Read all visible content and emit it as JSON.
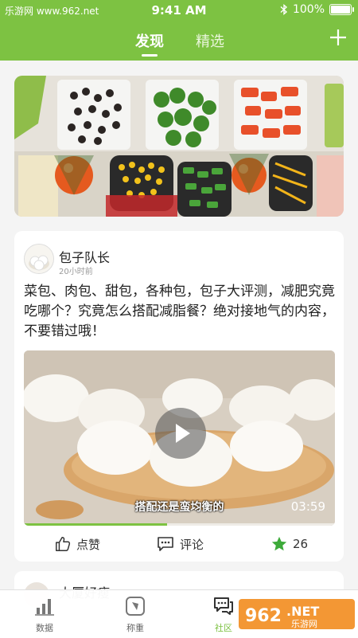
{
  "status_bar": {
    "carrier": "乐游网 www.962.net",
    "time": "9:41 AM",
    "battery": "100%",
    "battery_level": 1.0
  },
  "header": {
    "tabs": [
      {
        "label": "发现",
        "active": true
      },
      {
        "label": "精选",
        "active": false
      }
    ],
    "add_icon": "plus-icon"
  },
  "post": {
    "author": "包子队长",
    "time": "20小时前",
    "text": "菜包、肉包、甜包，各种包，包子大评测，减肥究竟吃哪个？究竟怎么搭配减脂餐？绝对接地气的内容，不要错过哦！",
    "video": {
      "caption": "搭配还是蛮均衡的",
      "duration": "03:59",
      "progress": 0.46
    },
    "actions": {
      "like_label": "点赞",
      "comment_label": "评论",
      "collect_count": "26"
    }
  },
  "next_post": {
    "author": "大厦好瘦"
  },
  "bottom_nav": [
    {
      "label": "数据",
      "icon": "bar-chart-icon",
      "active": false
    },
    {
      "label": "称重",
      "icon": "scale-icon",
      "active": false
    },
    {
      "label": "社区",
      "icon": "chat-icon",
      "active": true
    }
  ],
  "watermark": {
    "text": "962.NET",
    "subtext": "乐游网"
  },
  "colors": {
    "accent": "#7dc242",
    "background": "#f4f4f4"
  }
}
